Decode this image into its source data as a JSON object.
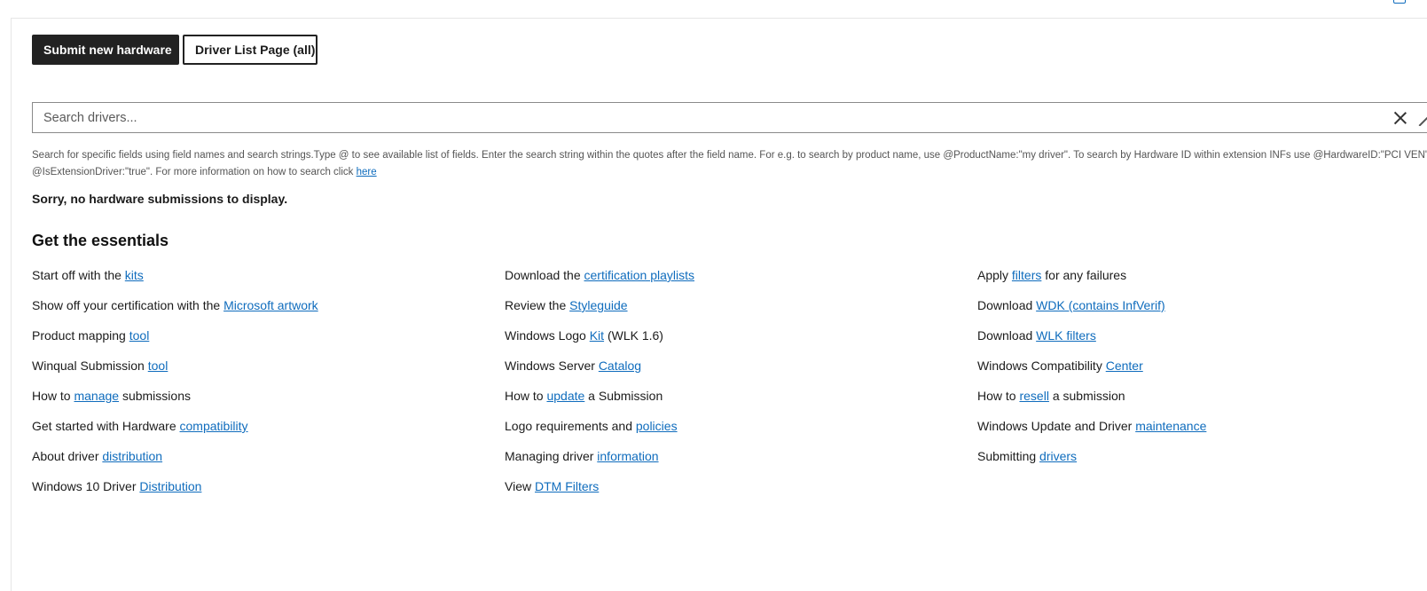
{
  "toolbar": {
    "submit_label": "Submit new hardware",
    "driver_list_label": "Driver List Page (all)"
  },
  "search": {
    "placeholder": "Search drivers...",
    "value": ""
  },
  "help": {
    "line1": "Search for specific fields using field names and search strings.Type @ to see available list of fields. Enter the search string within the quotes after the field name. For e.g. to search by product name, use @ProductName:\"my driver\". To search by Hardware ID within extension INFs use @HardwareID:\"PCI VEN\" and",
    "line2_text": "@IsExtensionDriver:\"true\". For more information on how to search click ",
    "line2_link": "here"
  },
  "empty_message": "Sorry, no hardware submissions to display.",
  "essentials": {
    "title": "Get the essentials",
    "columns": [
      [
        {
          "pre": "Start off with the ",
          "link": "kits",
          "post": ""
        },
        {
          "pre": "Show off your certification with the ",
          "link": "Microsoft artwork",
          "post": ""
        },
        {
          "pre": "Product mapping ",
          "link": "tool",
          "post": ""
        },
        {
          "pre": "Winqual Submission ",
          "link": "tool",
          "post": ""
        },
        {
          "pre": "How to ",
          "link": "manage",
          "post": " submissions"
        },
        {
          "pre": "Get started with Hardware ",
          "link": "compatibility",
          "post": ""
        },
        {
          "pre": "About driver ",
          "link": "distribution",
          "post": ""
        },
        {
          "pre": "Windows 10 Driver ",
          "link": "Distribution",
          "post": ""
        }
      ],
      [
        {
          "pre": "Download the ",
          "link": "certification playlists",
          "post": ""
        },
        {
          "pre": "Review the ",
          "link": "Styleguide",
          "post": ""
        },
        {
          "pre": "Windows Logo ",
          "link": "Kit",
          "post": " (WLK 1.6)"
        },
        {
          "pre": "Windows Server ",
          "link": "Catalog",
          "post": ""
        },
        {
          "pre": "How to ",
          "link": "update",
          "post": " a Submission"
        },
        {
          "pre": "Logo requirements and ",
          "link": "policies",
          "post": ""
        },
        {
          "pre": "Managing driver ",
          "link": "information",
          "post": ""
        },
        {
          "pre": "View ",
          "link": "DTM Filters",
          "post": ""
        }
      ],
      [
        {
          "pre": "Apply ",
          "link": "filters",
          "post": " for any failures"
        },
        {
          "pre": "Download ",
          "link": "WDK (contains InfVerif)",
          "post": ""
        },
        {
          "pre": "Download ",
          "link": "WLK filters",
          "post": ""
        },
        {
          "pre": "Windows Compatibility ",
          "link": "Center",
          "post": ""
        },
        {
          "pre": "How to ",
          "link": "resell",
          "post": " a submission"
        },
        {
          "pre": "Windows Update and Driver ",
          "link": "maintenance",
          "post": ""
        },
        {
          "pre": "Submitting ",
          "link": "drivers",
          "post": ""
        }
      ]
    ]
  }
}
